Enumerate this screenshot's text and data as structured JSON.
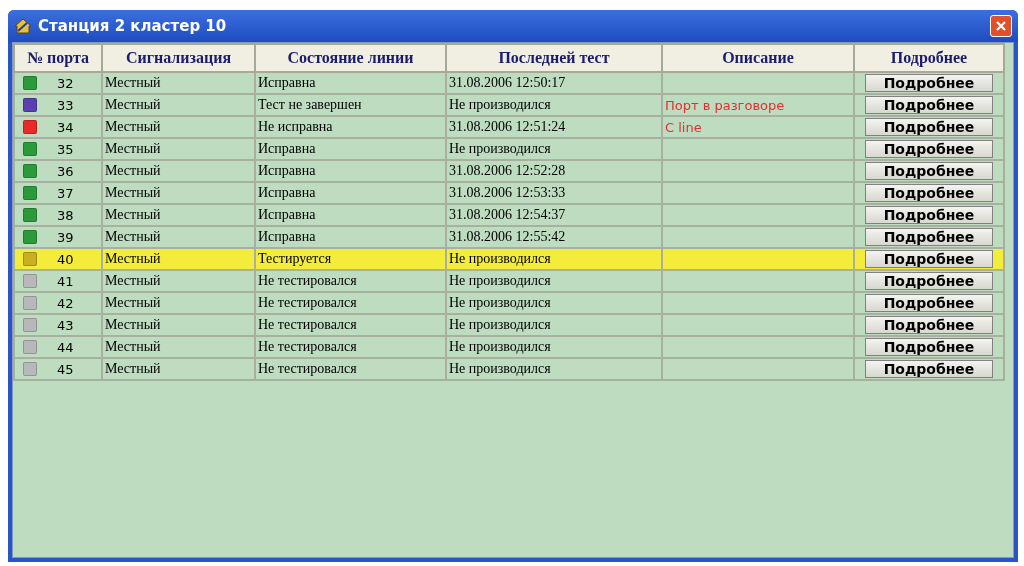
{
  "window": {
    "title": "Станция 2 кластер 10"
  },
  "table": {
    "columns": [
      "№ порта",
      "Сигнализация",
      "Состояние линии",
      "Последней тест",
      "Описание",
      "Подробнее"
    ],
    "rows": [
      {
        "port": "32",
        "signaling": "Местный",
        "state": "Исправна",
        "last_test": "31.08.2006 12:50:17",
        "description": "",
        "details": "Подробнее",
        "color": "#2a9a3a",
        "selected": false
      },
      {
        "port": "33",
        "signaling": "Местный",
        "state": "Тест не завершен",
        "last_test": "Не производился",
        "description": "Порт в разговоре",
        "details": "Подробнее",
        "color": "#5a3fb0",
        "selected": false
      },
      {
        "port": "34",
        "signaling": "Местный",
        "state": "Не исправна",
        "last_test": "31.08.2006 12:51:24",
        "description": "C line",
        "details": "Подробнее",
        "color": "#e82a2a",
        "selected": false
      },
      {
        "port": "35",
        "signaling": "Местный",
        "state": "Исправна",
        "last_test": "Не производился",
        "description": "",
        "details": "Подробнее",
        "color": "#2a9a3a",
        "selected": false
      },
      {
        "port": "36",
        "signaling": "Местный",
        "state": "Исправна",
        "last_test": "31.08.2006 12:52:28",
        "description": "",
        "details": "Подробнее",
        "color": "#2a9a3a",
        "selected": false
      },
      {
        "port": "37",
        "signaling": "Местный",
        "state": "Исправна",
        "last_test": "31.08.2006 12:53:33",
        "description": "",
        "details": "Подробнее",
        "color": "#2a9a3a",
        "selected": false
      },
      {
        "port": "38",
        "signaling": "Местный",
        "state": "Исправна",
        "last_test": "31.08.2006 12:54:37",
        "description": "",
        "details": "Подробнее",
        "color": "#2a9a3a",
        "selected": false
      },
      {
        "port": "39",
        "signaling": "Местный",
        "state": "Исправна",
        "last_test": "31.08.2006 12:55:42",
        "description": "",
        "details": "Подробнее",
        "color": "#2a9a3a",
        "selected": false
      },
      {
        "port": "40",
        "signaling": "Местный",
        "state": "Тестируется",
        "last_test": "Не производился",
        "description": "",
        "details": "Подробнее",
        "color": "#c8b020",
        "selected": true
      },
      {
        "port": "41",
        "signaling": "Местный",
        "state": "Не тестировался",
        "last_test": "Не производился",
        "description": "",
        "details": "Подробнее",
        "color": "#b8b8b8",
        "selected": false
      },
      {
        "port": "42",
        "signaling": "Местный",
        "state": "Не тестировался",
        "last_test": "Не производился",
        "description": "",
        "details": "Подробнее",
        "color": "#b8b8b8",
        "selected": false
      },
      {
        "port": "43",
        "signaling": "Местный",
        "state": "Не тестировался",
        "last_test": "Не производился",
        "description": "",
        "details": "Подробнее",
        "color": "#b8b8b8",
        "selected": false
      },
      {
        "port": "44",
        "signaling": "Местный",
        "state": "Не тестировался",
        "last_test": "Не производился",
        "description": "",
        "details": "Подробнее",
        "color": "#b8b8b8",
        "selected": false
      },
      {
        "port": "45",
        "signaling": "Местный",
        "state": "Не тестировался",
        "last_test": "Не производился",
        "description": "",
        "details": "Подробнее",
        "color": "#b8b8b8",
        "selected": false
      }
    ]
  }
}
